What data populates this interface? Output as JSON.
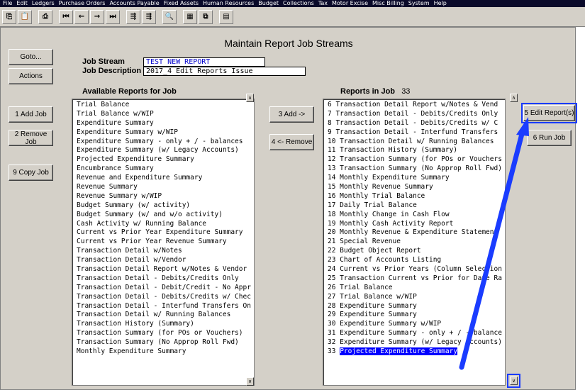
{
  "menu": [
    "File",
    "Edit",
    "Ledgers",
    "Purchase Orders",
    "Accounts Payable",
    "Fixed Assets",
    "Human Resources",
    "Budget",
    "Collections",
    "Tax",
    "Motor Excise",
    "Misc Billing",
    "System",
    "Help"
  ],
  "toolbar": {
    "icons": [
      "copy-icon",
      "paste-icon",
      "print-icon",
      "first-record-icon",
      "previous-record-icon",
      "next-record-icon",
      "last-record-icon",
      "find-icon",
      "find-next-icon",
      "search-icon",
      "spreadsheet-icon",
      "export-icon",
      "chart-icon"
    ],
    "glyphs": [
      "⎘",
      "📋",
      "⎙",
      "⏮",
      "←",
      "→",
      "⏭",
      "⇶",
      "⇶",
      "🔍",
      "▦",
      "⧉",
      "▤"
    ]
  },
  "title": "Maintain Report Job Streams",
  "buttons": {
    "goto": "Goto...",
    "actions": "Actions",
    "add_job": "1 Add Job",
    "remove_job": "2 Remove Job",
    "copy_job": "9 Copy Job",
    "add": "3 Add ->",
    "remove": "4 <- Remove",
    "edit_reports": "5 Edit Report(s)",
    "run_job": "6 Run Job"
  },
  "form": {
    "job_stream_label": "Job Stream",
    "job_stream_value": "TEST NEW REPORT",
    "job_description_label": "Job Description",
    "job_description_value": "2017_4 Edit Reports Issue"
  },
  "available": {
    "label": "Available Reports for Job",
    "items": [
      "Trial Balance",
      "Trial Balance w/WIP",
      "Expenditure Summary",
      "Expenditure Summary w/WIP",
      "Expenditure Summary - only + / - balances",
      "Expenditure Summary (w/ Legacy Accounts)",
      "Projected Expenditure Summary",
      "Encumbrance Summary",
      "Revenue and Expenditure Summary",
      "Revenue Summary",
      "Revenue Summary w/WIP",
      "Budget Summary (w/ activity)",
      "Budget Summary (w/ and w/o activity)",
      "Cash Activity w/ Running Balance",
      "Current vs Prior Year Expenditure Summary",
      "Current vs Prior Year Revenue Summary",
      "Transaction Detail w/Notes",
      "Transaction Detail w/Vendor",
      "Transaction Detail Report w/Notes & Vendor",
      "Transaction Detail - Debits/Credits Only",
      "Transaction Detail - Debit/Credit - No Appr",
      "Transaction Detail - Debits/Credits w/ Chec",
      "Transaction Detail - Interfund Transfers On",
      "Transaction Detail w/ Running Balances",
      "Transaction History (Summary)",
      "Transaction Summary (for POs or Vouchers)",
      "Transaction Summary (No Approp Roll Fwd)",
      "Monthly Expenditure Summary"
    ]
  },
  "in_job": {
    "label": "Reports in Job",
    "count": "33",
    "items": [
      "6 Transaction Detail Report w/Notes & Vend",
      "7 Transaction Detail - Debits/Credits Only",
      "8 Transaction Detail - Debits/Credits w/ C",
      "9 Transaction Detail - Interfund Transfers",
      "10 Transaction Detail w/ Running Balances",
      "11 Transaction History (Summary)",
      "12 Transaction Summary (for POs or Vouchers",
      "13 Transaction Summary (No Approp Roll Fwd)",
      "14 Monthly Expenditure Summary",
      "15 Monthly Revenue Summary",
      "16 Monthly Trial Balance",
      "17 Daily Trial Balance",
      "18 Monthly Change in Cash Flow",
      "19 Monthly Cash Activity Report",
      "20 Monthly Revenue & Expenditure Statement",
      "21 Special Revenue",
      "22 Budget Object Report",
      "23 Chart of Accounts Listing",
      "24 Current vs Prior Years (Column Selection",
      "25 Transaction Current vs Prior for Date Ra",
      "26 Trial Balance",
      "27 Trial Balance w/WIP",
      "28 Expenditure Summary",
      "29 Expenditure Summary",
      "30 Expenditure Summary w/WIP",
      "31 Expenditure Summary - only + / - balance",
      "32 Expenditure Summary (w/ Legacy Accounts)"
    ],
    "selected_number": "33",
    "selected_text": "Projected Expenditure Summary"
  },
  "scroll": {
    "up": "∧",
    "down": "∨"
  },
  "colors": {
    "selection": "#0000ff",
    "annotation": "#1a3cff",
    "field_text": "#0000cc"
  }
}
